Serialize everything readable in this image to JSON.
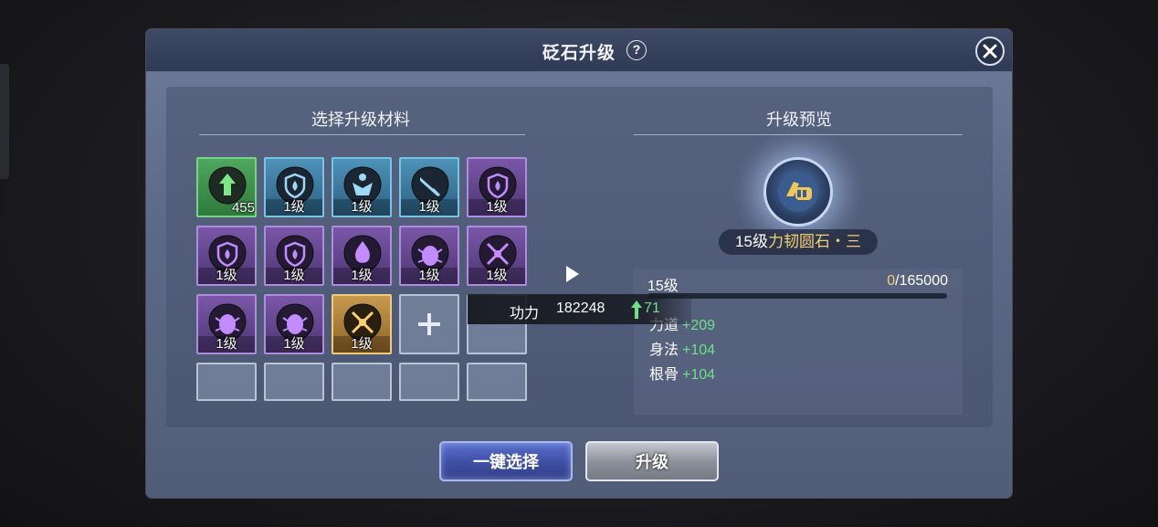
{
  "dialog": {
    "title": "砭石升级",
    "help_symbol": "?"
  },
  "left_panel": {
    "title": "选择升级材料",
    "slots": [
      {
        "rarity": "green",
        "icon": "upgrade-arrow-gem",
        "count": "455"
      },
      {
        "rarity": "blue",
        "icon": "shield-gem",
        "level": "1级"
      },
      {
        "rarity": "blue",
        "icon": "figure-gem",
        "level": "1级"
      },
      {
        "rarity": "blue",
        "icon": "sword-gem",
        "level": "1级"
      },
      {
        "rarity": "purple",
        "icon": "shield-drop-gem",
        "level": "1级"
      },
      {
        "rarity": "purple",
        "icon": "shield-drop-gem",
        "level": "1级"
      },
      {
        "rarity": "purple",
        "icon": "shield-drop-gem",
        "level": "1级"
      },
      {
        "rarity": "purple",
        "icon": "flame-gem",
        "level": "1级"
      },
      {
        "rarity": "purple",
        "icon": "beetle-gem",
        "level": "1级"
      },
      {
        "rarity": "purple",
        "icon": "crossed-swords-gem",
        "level": "1级"
      },
      {
        "rarity": "purple",
        "icon": "beetle-gem",
        "level": "1级"
      },
      {
        "rarity": "purple",
        "icon": "beetle-gem",
        "level": "1级"
      },
      {
        "rarity": "gold",
        "icon": "golden-swords-gem",
        "level": "1级"
      },
      {
        "rarity": "empty",
        "icon": "plus-icon"
      },
      {
        "rarity": "empty"
      },
      {
        "rarity": "empty"
      },
      {
        "rarity": "empty"
      },
      {
        "rarity": "empty"
      },
      {
        "rarity": "empty"
      },
      {
        "rarity": "empty"
      }
    ]
  },
  "right_panel": {
    "title": "升级预览",
    "item": {
      "level": "15级",
      "name": "力韧圆石・三",
      "icon": "fist-stone-icon"
    },
    "exp": {
      "level_label": "15级",
      "current": "0",
      "max": "/165000",
      "progress": 0
    },
    "stats": [
      {
        "name": "力道",
        "value": "+209"
      },
      {
        "name": "身法",
        "value": "+104"
      },
      {
        "name": "根骨",
        "value": "+104"
      }
    ]
  },
  "tooltip": {
    "label": "功力",
    "value": "182248",
    "gain": "71"
  },
  "buttons": {
    "auto_select": "一键选择",
    "upgrade": "升级"
  },
  "colors": {
    "accent_gold": "#f4cf72",
    "gain_green": "#6fe08a",
    "primary_button": "#3f4ea3"
  }
}
